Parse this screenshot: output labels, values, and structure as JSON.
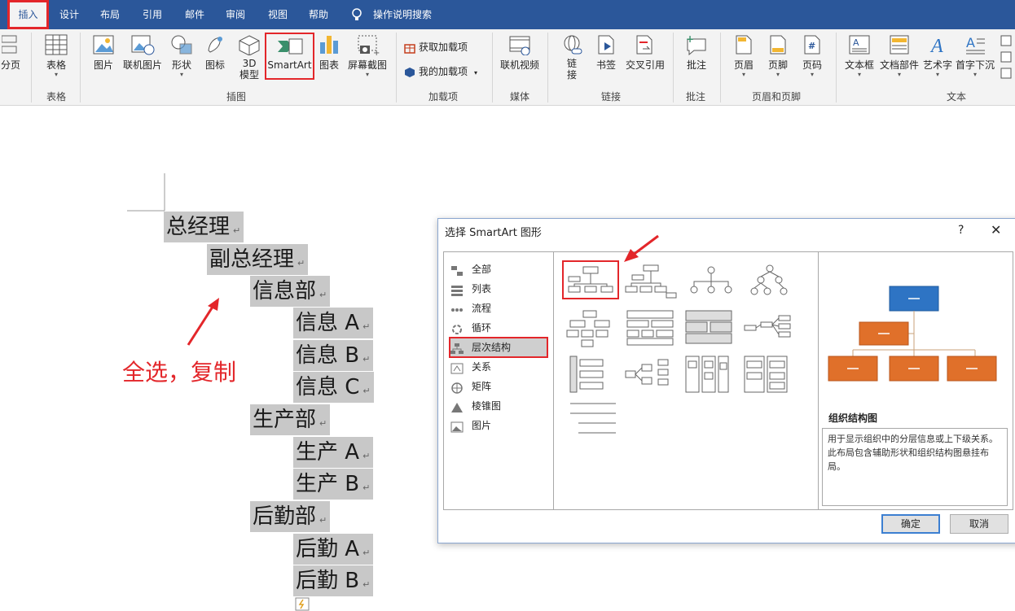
{
  "tabs": [
    "插入",
    "设计",
    "布局",
    "引用",
    "邮件",
    "审阅",
    "视图",
    "帮助",
    "操作说明搜索"
  ],
  "ribbon": {
    "page_break_label": "分页",
    "table_label": "表格",
    "picture_label": "图片",
    "online_picture_label": "联机图片",
    "shapes_label": "形状",
    "icons_label": "图标",
    "model3d_label_1": "3D",
    "model3d_label_2": "模型",
    "smartart_label": "SmartArt",
    "chart_label": "图表",
    "screenshot_label": "屏幕截图",
    "get_addins_label": "获取加载项",
    "my_addins_label": "我的加载项",
    "online_video_label": "联机视频",
    "link_label_1": "链",
    "link_label_2": "接",
    "bookmark_label": "书签",
    "crossref_label": "交叉引用",
    "comment_label": "批注",
    "header_label": "页眉",
    "footer_label": "页脚",
    "pagenum_label": "页码",
    "textbox_label": "文本框",
    "quickparts_label": "文档部件",
    "wordart_label": "艺术字",
    "dropcap_label": "首字下沉",
    "groups": {
      "tables": "表格",
      "illustrations": "插图",
      "addins": "加载项",
      "media": "媒体",
      "links": "链接",
      "comments": "批注",
      "headerfooter": "页眉和页脚",
      "text": "文本"
    }
  },
  "document": {
    "lines": [
      "总经理",
      "副总经理",
      "信息部",
      "信息 A",
      "信息 B",
      "信息 C",
      "生产部",
      "生产 A",
      "生产 B",
      "后勤部",
      "后勤 A",
      "后勤 B"
    ],
    "paragraph_mark": "↵",
    "annotation": "全选，复制",
    "annotation_color": "#e3262a"
  },
  "dialog": {
    "title": "选择 SmartArt 图形",
    "help": "?",
    "close": "✕",
    "categories": [
      "全部",
      "列表",
      "流程",
      "循环",
      "层次结构",
      "关系",
      "矩阵",
      "棱锥图",
      "图片"
    ],
    "selected_category": "层次结构",
    "preview_title": "组织结构图",
    "preview_desc": "用于显示组织中的分层信息或上下级关系。此布局包含辅助形状和组织结构图悬挂布局。",
    "ok_label": "确定",
    "cancel_label": "取消"
  },
  "colors": {
    "tabbar": "#2b579a",
    "highlight": "#e3262a",
    "preview_top": "#2e74c4",
    "preview_boxes": "#e0702a"
  }
}
